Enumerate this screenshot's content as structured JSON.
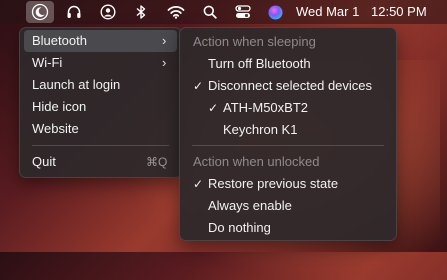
{
  "menubar": {
    "icons": [
      "app-moon-icon",
      "headphones-icon",
      "user-circle-icon",
      "bluetooth-icon",
      "wifi-icon",
      "search-icon",
      "control-center-icon",
      "siri-icon"
    ],
    "date": "Wed Mar 1",
    "time": "12:50 PM"
  },
  "main_menu": {
    "items": [
      {
        "label": "Bluetooth",
        "submenu": true
      },
      {
        "label": "Wi-Fi",
        "submenu": true
      },
      {
        "label": "Launch at login"
      },
      {
        "label": "Hide icon"
      },
      {
        "label": "Website"
      },
      {
        "label": "Quit",
        "shortcut": "⌘Q"
      }
    ]
  },
  "sub_menu": {
    "sleep_header": "Action when sleeping",
    "sleep_items": [
      {
        "label": "Turn off Bluetooth",
        "checked": false
      },
      {
        "label": "Disconnect selected devices",
        "checked": true
      },
      {
        "label": "ATH-M50xBT2",
        "checked": true
      },
      {
        "label": "Keychron K1",
        "checked": false
      }
    ],
    "unlock_header": "Action when unlocked",
    "unlock_items": [
      {
        "label": "Restore previous state",
        "checked": true
      },
      {
        "label": "Always enable",
        "checked": false
      },
      {
        "label": "Do nothing",
        "checked": false
      }
    ]
  }
}
